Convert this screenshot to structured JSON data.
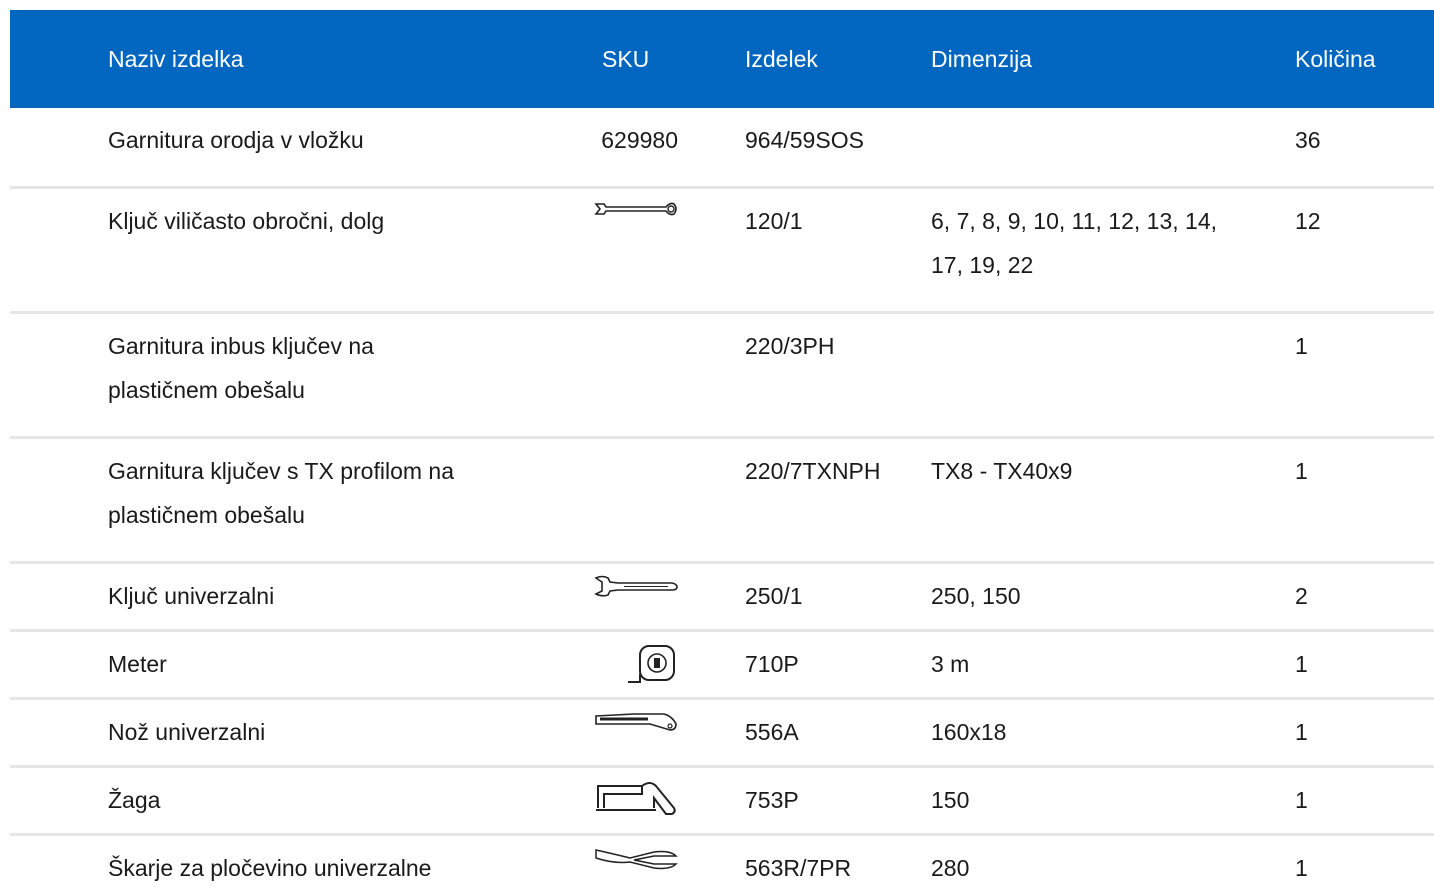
{
  "columns": {
    "name": "Naziv izdelka",
    "sku": "SKU",
    "product": "Izdelek",
    "dimension": "Dimenzija",
    "quantity": "Količina"
  },
  "rows": [
    {
      "name": "Garnitura orodja v vložku",
      "sku": "629980",
      "icon": "",
      "product": "964/59SOS",
      "dimension": "",
      "quantity": "36"
    },
    {
      "name": "Ključ viličasto obročni, dolg",
      "sku": "",
      "icon": "combination-wrench-icon",
      "product": "120/1",
      "dimension": "6, 7, 8, 9, 10, 11, 12, 13, 14, 17, 19, 22",
      "quantity": "12"
    },
    {
      "name": "Garnitura inbus ključev na plastičnem obešalu",
      "sku": "",
      "icon": "",
      "product": "220/3PH",
      "dimension": "",
      "quantity": "1"
    },
    {
      "name": "Garnitura ključev s TX profilom na plastičnem obešalu",
      "sku": "",
      "icon": "",
      "product": "220/7TXNPH",
      "dimension": "TX8 - TX40x9",
      "quantity": "1"
    },
    {
      "name": "Ključ univerzalni",
      "sku": "",
      "icon": "adjustable-wrench-icon",
      "product": "250/1",
      "dimension": "250, 150",
      "quantity": "2"
    },
    {
      "name": "Meter",
      "sku": "",
      "icon": "tape-measure-icon",
      "product": "710P",
      "dimension": "3 m",
      "quantity": "1"
    },
    {
      "name": "Nož univerzalni",
      "sku": "",
      "icon": "utility-knife-icon",
      "product": "556A",
      "dimension": "160x18",
      "quantity": "1"
    },
    {
      "name": "Žaga",
      "sku": "",
      "icon": "hacksaw-icon",
      "product": "753P",
      "dimension": "150",
      "quantity": "1"
    },
    {
      "name": "Škarje za pločevino univerzalne",
      "sku": "",
      "icon": "tin-snips-icon",
      "product": "563R/7PR",
      "dimension": "280",
      "quantity": "1"
    }
  ],
  "colors": {
    "header_bg": "#0066bf",
    "header_text": "#ffffff",
    "divider": "#e6e6e6"
  }
}
